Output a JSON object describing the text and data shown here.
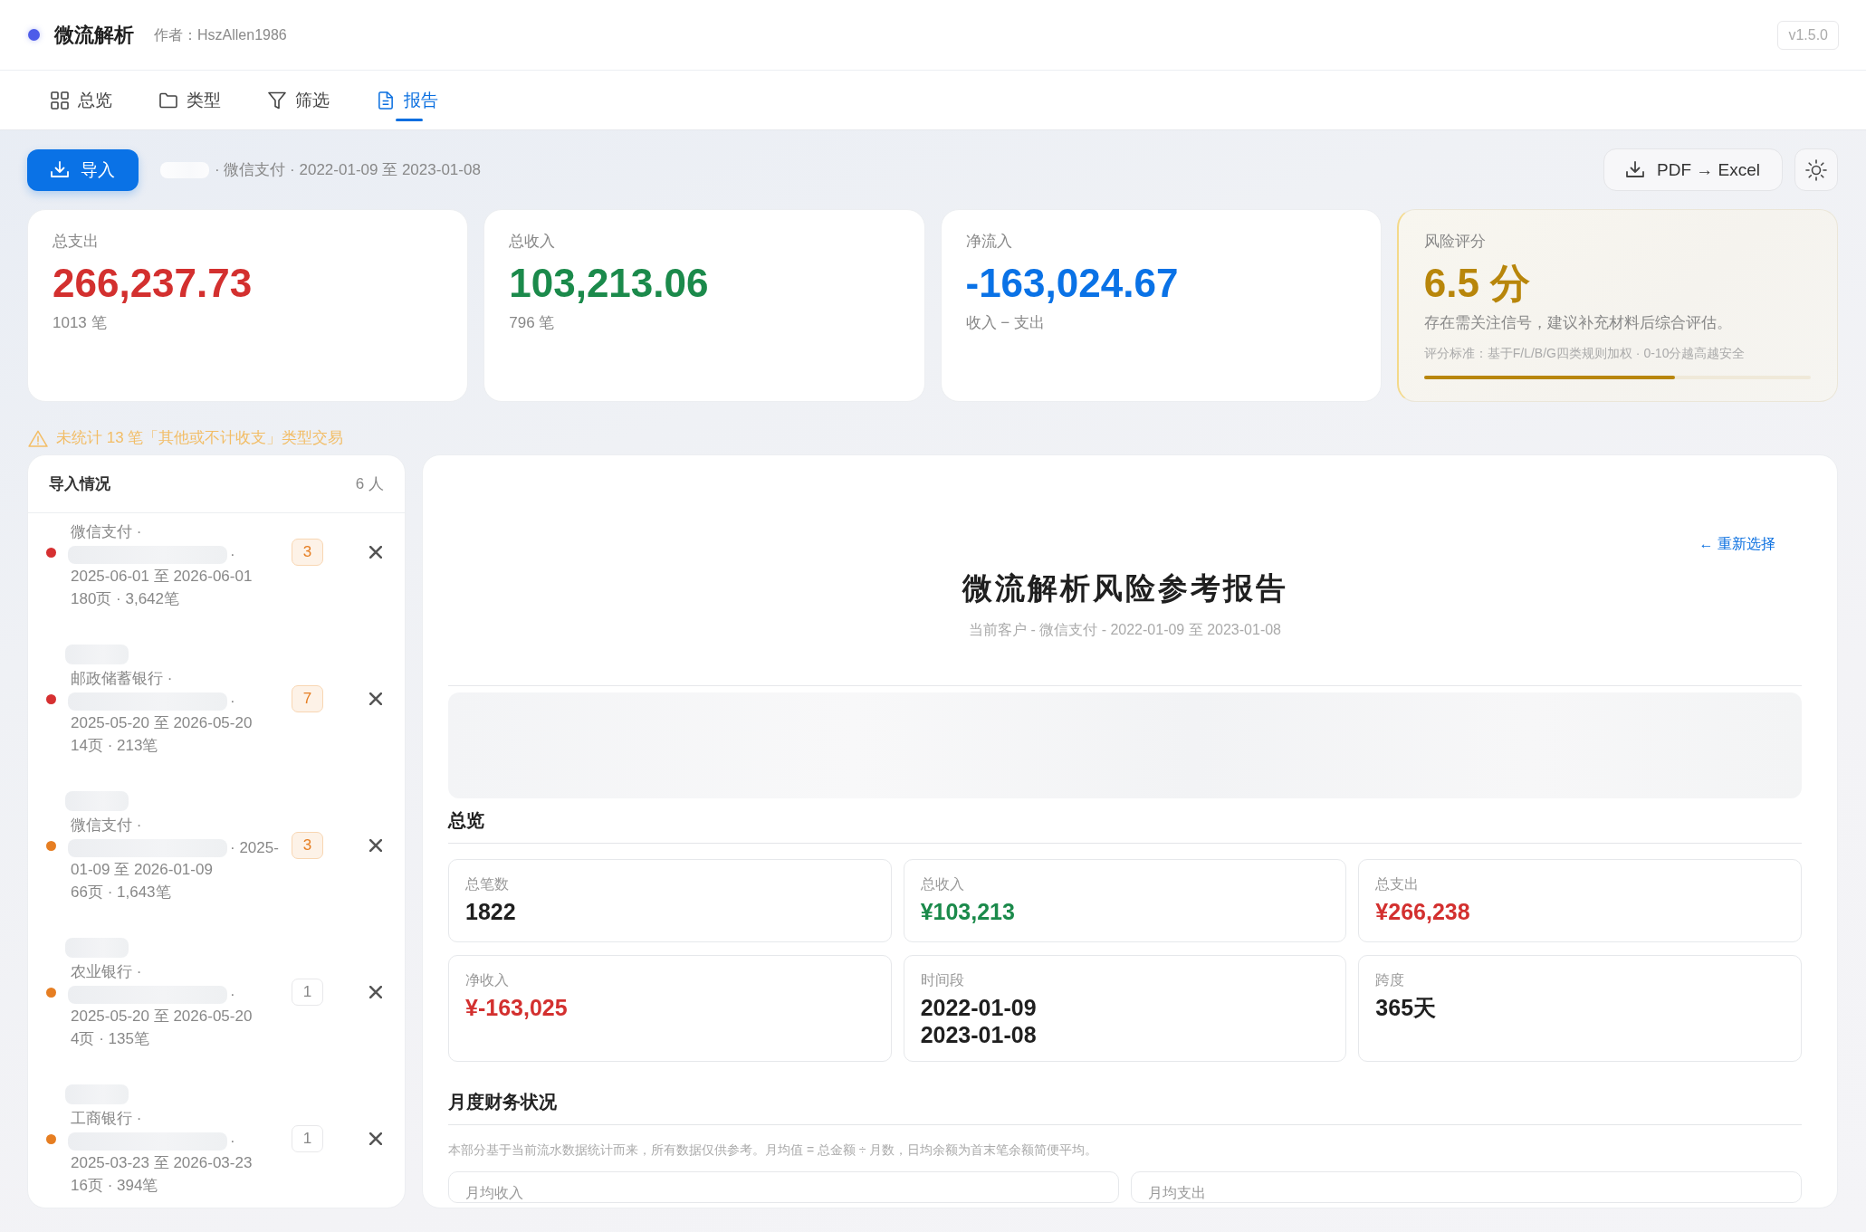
{
  "app": {
    "title": "微流解析",
    "author": "作者：HszAllen1986",
    "version": "v1.5.0"
  },
  "tabs": [
    {
      "label": "总览",
      "selected": false
    },
    {
      "label": "类型",
      "selected": false
    },
    {
      "label": "筛选",
      "selected": false
    },
    {
      "label": "报告",
      "selected": true
    }
  ],
  "toolbar": {
    "import_button": "导入",
    "context": "· 微信支付 · 2022-01-09 至 2023-01-08",
    "convert_button": "PDF → Excel"
  },
  "stats": [
    {
      "kind": "expense",
      "label": "总支出",
      "value": "266,237.73",
      "note": "1013 笔"
    },
    {
      "kind": "income",
      "label": "总收入",
      "value": "103,213.06",
      "note": "796 笔"
    },
    {
      "kind": "net",
      "label": "净流入",
      "value": "-163,024.67",
      "note": "收入 − 支出"
    },
    {
      "kind": "risk",
      "label": "风险评分",
      "value": "6.5 分",
      "note": "存在需关注信号，建议补充材料后综合评估。",
      "criteria": "评分标准：基于F/L/B/G四类规则加权 · 0-10分越高越安全",
      "level": 0.65
    }
  ],
  "warning": "未统计 13 笔「其他或不计收支」类型交易",
  "imports": {
    "title": "导入情况",
    "count": "6 人",
    "items": [
      {
        "color": "#d63031",
        "source": "微信支付 ·",
        "tail": "·",
        "dates": "2025-06-01 至 2026-06-01",
        "meta": "180页 · 3,642笔",
        "badge": {
          "text": "3",
          "kind": "warn"
        }
      },
      {
        "color": "#d63031",
        "source": "邮政储蓄银行 ·",
        "tail": "·",
        "dates": "2025-05-20 至 2026-05-20",
        "meta": "14页 · 213笔",
        "badge": {
          "text": "7",
          "kind": "warn"
        }
      },
      {
        "color": "#e67e22",
        "source": "微信支付 ·",
        "tail": "· 2025-",
        "dates": "01-09 至 2026-01-09",
        "meta": "66页 · 1,643笔",
        "badge": {
          "text": "3",
          "kind": "warn"
        }
      },
      {
        "color": "#e67e22",
        "source": "农业银行 ·",
        "tail": "·",
        "dates": "2025-05-20 至 2026-05-20",
        "meta": "4页 · 135笔",
        "badge": {
          "text": "1",
          "kind": "plain"
        }
      },
      {
        "color": "#e67e22",
        "source": "工商银行 ·",
        "tail": "·",
        "dates": "2025-03-23 至 2026-03-23",
        "meta": "16页 · 394笔",
        "badge": {
          "text": "1",
          "kind": "plain"
        }
      }
    ]
  },
  "report": {
    "back_link": "← 重新选择",
    "title": "微流解析风险参考报告",
    "subtitle": "当前客户 - 微信支付 - 2022-01-09 至 2023-01-08",
    "sections": [
      {
        "heading": "总览",
        "cells": [
          {
            "label": "总笔数",
            "lines": [
              "1822"
            ],
            "kind": "neutral"
          },
          {
            "label": "总收入",
            "lines": [
              "¥103,213"
            ],
            "kind": "positive"
          },
          {
            "label": "总支出",
            "lines": [
              "¥266,238"
            ],
            "kind": "negative"
          },
          {
            "label": "净收入",
            "lines": [
              "¥-163,025"
            ],
            "kind": "negative"
          },
          {
            "label": "时间段",
            "lines": [
              "2022-01-09",
              "2023-01-08"
            ],
            "kind": "neutral"
          },
          {
            "label": "跨度",
            "lines": [
              "365天"
            ],
            "kind": "neutral"
          }
        ]
      },
      {
        "heading": "月度财务状况",
        "note": "本部分基于当前流水数据统计而来，所有数据仅供参考。月均值 = 总金额 ÷ 月数，日均余额为首末笔余额简便平均。",
        "cells": [
          {
            "label": "月均收入"
          },
          {
            "label": "月均支出"
          }
        ]
      }
    ]
  }
}
